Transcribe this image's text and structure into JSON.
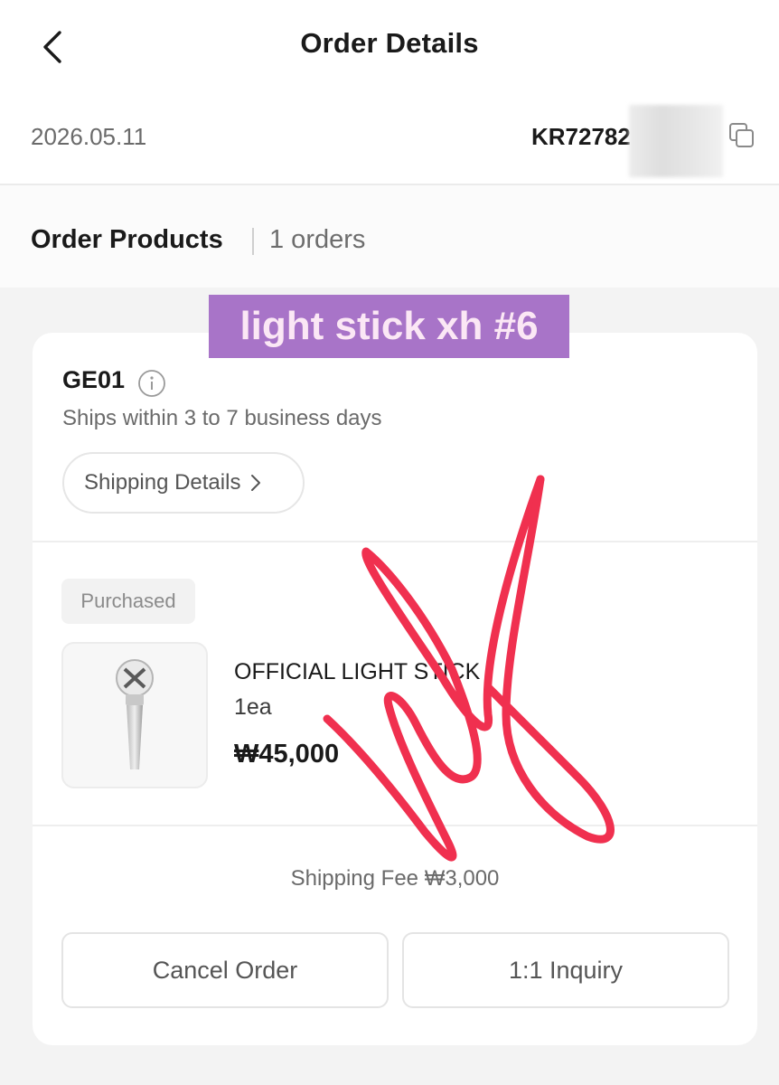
{
  "header": {
    "title": "Order Details",
    "back_icon": "chevron-left-icon"
  },
  "order": {
    "date": "2026.05.11",
    "number_visible": "KR72782",
    "copy_icon": "copy-icon"
  },
  "section": {
    "title": "Order Products",
    "count": "1 orders"
  },
  "overlay_label": "light stick xh #6",
  "seller": {
    "name": "GE01",
    "info_icon": "info-icon",
    "ship_note": "Ships within 3 to 7 business days",
    "details_button": "Shipping Details"
  },
  "item": {
    "status": "Purchased",
    "name": "OFFICIAL LIGHT STICK",
    "qty": "1ea",
    "price": "₩45,000",
    "thumbnail_icon": "light-stick-icon"
  },
  "shipping_fee": "Shipping Fee ₩3,000",
  "actions": {
    "cancel": "Cancel Order",
    "inquiry": "1:1 Inquiry"
  },
  "colors": {
    "overlay_bg": "#a874c8",
    "scribble": "#f0304f",
    "page_bg": "#f3f3f3"
  }
}
